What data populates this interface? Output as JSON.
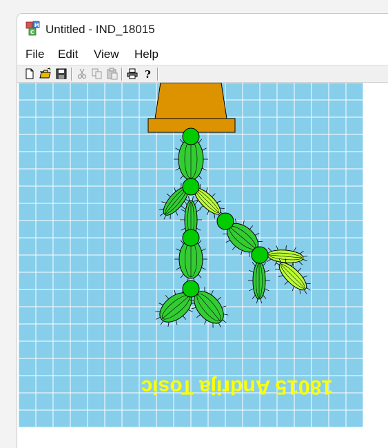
{
  "window": {
    "title": "Untitled - IND_18015",
    "app_icon": "mfc-app-icon"
  },
  "menu": {
    "items": [
      "File",
      "Edit",
      "View",
      "Help"
    ]
  },
  "toolbar": {
    "buttons": [
      "new-icon",
      "open-icon",
      "save-icon",
      "cut-icon",
      "copy-icon",
      "paste-icon",
      "print-icon",
      "help-icon"
    ]
  },
  "canvas": {
    "background_color": "#87CEEB",
    "grid_color": "#ffffff",
    "pot_color": "#DD9300",
    "cactus_color": "#33CC33",
    "cactus_light_color": "#BBFF33",
    "joint_color": "#00CC00",
    "signature_text": "18015 Andrija Tosic",
    "signature_color": "#FFFF00"
  }
}
